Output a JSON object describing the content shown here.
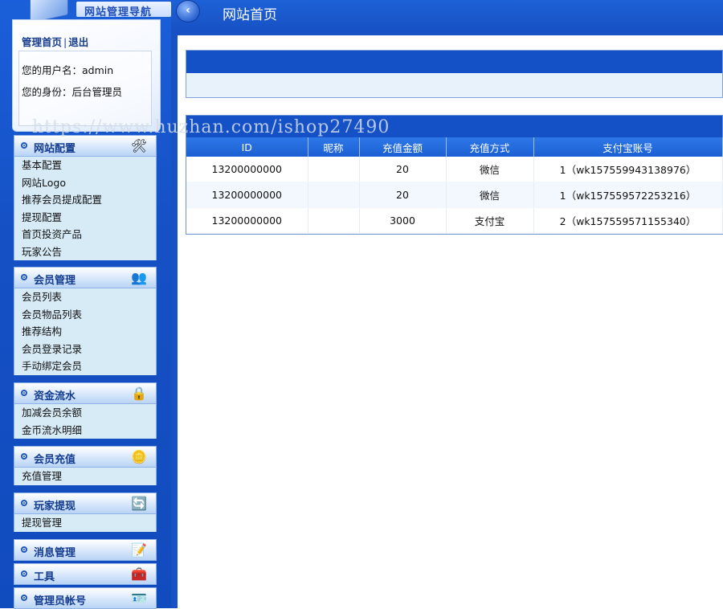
{
  "sidebar": {
    "nav_title": "网站管理导航",
    "links": {
      "home": "管理首页",
      "separator": "|",
      "logout": "退出"
    },
    "user": {
      "username_line": "您的用户名：admin",
      "role_line": "您的身份：后台管理员"
    },
    "groups": [
      {
        "title": "网站配置",
        "icon": "tools-icon",
        "items": [
          "基本配置",
          "网站Logo",
          "推荐会员提成配置",
          "提现配置",
          "首页投资产品",
          "玩家公告"
        ]
      },
      {
        "title": "会员管理",
        "icon": "users-icon",
        "items": [
          "会员列表",
          "会员物品列表",
          "推荐结构",
          "会员登录记录",
          "手动绑定会员"
        ]
      },
      {
        "title": "资金流水",
        "icon": "lock-icon",
        "items": [
          "加减会员余额",
          "金币流水明细"
        ]
      },
      {
        "title": "会员充值",
        "icon": "coins-icon",
        "items": [
          "充值管理"
        ]
      },
      {
        "title": "玩家提现",
        "icon": "exchange-icon",
        "items": [
          "提现管理"
        ]
      },
      {
        "title": "消息管理",
        "icon": "message-icon",
        "items": []
      },
      {
        "title": "工具",
        "icon": "toolbox-icon",
        "items": []
      },
      {
        "title": "管理员帐号",
        "icon": "admin-info-icon",
        "items": []
      }
    ]
  },
  "header": {
    "title": "网站首页"
  },
  "watermark": "https://www.huzhan.com/ishop27490",
  "table": {
    "columns": [
      "ID",
      "昵称",
      "充值金额",
      "充值方式",
      "支付宝账号"
    ],
    "rows": [
      [
        "13200000000",
        "",
        "20",
        "微信",
        "1（wk157559943138976）"
      ],
      [
        "13200000000",
        "",
        "20",
        "微信",
        "1（wk157559572253216）"
      ],
      [
        "13200000000",
        "",
        "3000",
        "支付宝",
        "2（wk157559571155340）"
      ]
    ]
  },
  "colors": {
    "primary_blue": "#1751c4",
    "sidebar_item_bg": "#d6ebf6",
    "header_text": "#ffffff"
  }
}
